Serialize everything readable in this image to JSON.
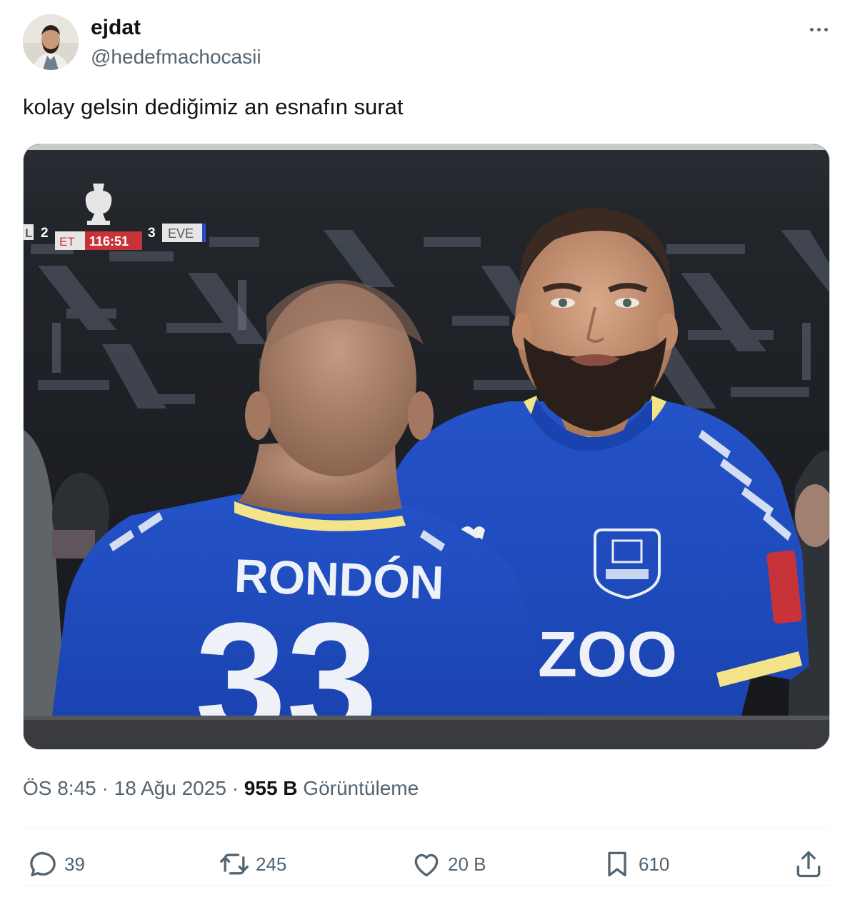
{
  "user": {
    "display_name": "ejdat",
    "handle": "@hedefmachocasii"
  },
  "tweet": {
    "text": "kolay gelsin dediğimiz an esnafın surat"
  },
  "media": {
    "scoreboard": {
      "home_short": "L",
      "home_score": "2",
      "period": "ET",
      "clock": "116:51",
      "away_score": "3",
      "away_short": "EVE"
    },
    "jersey_name": "RONDÓN",
    "jersey_number": "33",
    "sponsor_text": "ZOO"
  },
  "meta": {
    "time": "ÖS 8:45",
    "separator": "·",
    "date": "18 Ağu 2025",
    "views_count": "955 B",
    "views_label": "Görüntüleme"
  },
  "actions": {
    "replies": "39",
    "reposts": "245",
    "likes": "20 B",
    "bookmarks": "610"
  },
  "colors": {
    "text_primary": "#0f1419",
    "text_secondary": "#536471",
    "jersey_blue": "#1f4bc2",
    "scoreboard_red": "#c8333a"
  }
}
